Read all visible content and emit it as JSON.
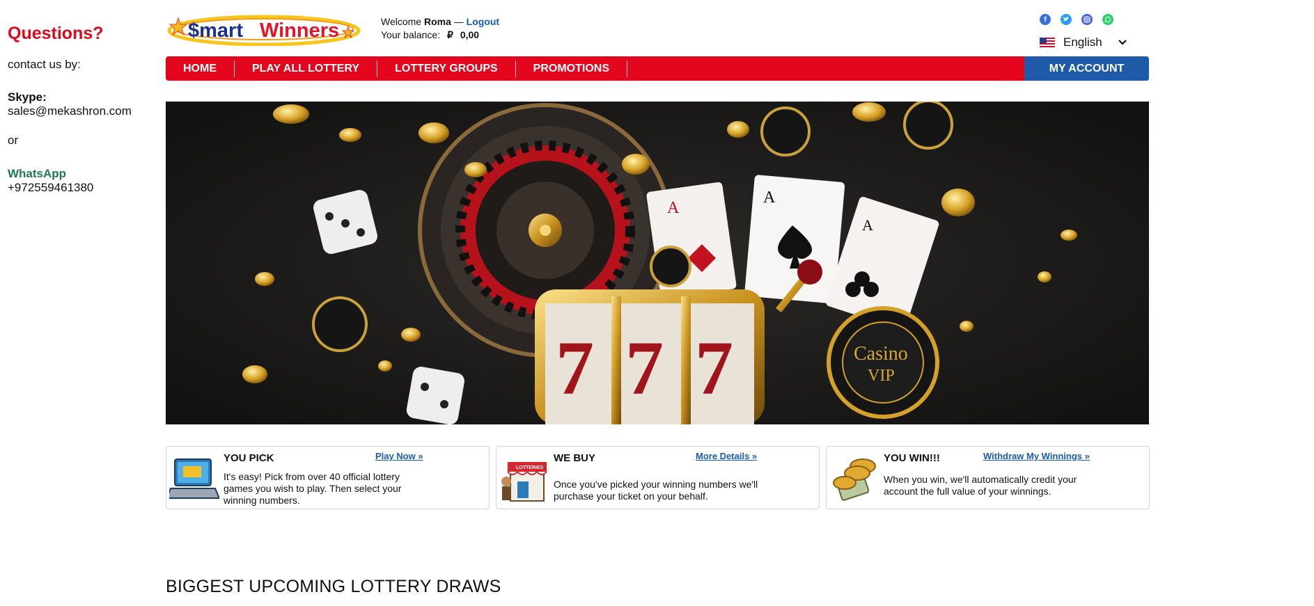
{
  "contact": {
    "heading": "Questions?",
    "intro": "contact us by:",
    "skype_label": "Skype:",
    "skype_value": "sales@mekashron.com",
    "or": "or",
    "whatsapp_label": "WhatsApp",
    "whatsapp_value": "+972559461380"
  },
  "logo": {
    "text_prefix": "$mart",
    "text_suffix": "Winners"
  },
  "header": {
    "welcome_label": "Welcome",
    "user_name": "Roma",
    "dash": "—",
    "logout": "Logout",
    "balance_label": "Your balance:",
    "currency_symbol": "₽",
    "balance_value": "0,00"
  },
  "social": {
    "icons": [
      "facebook-icon",
      "twitter-icon",
      "instagram-icon",
      "whatsapp-icon"
    ],
    "colors": [
      "#3b6fe0",
      "#2a9df4",
      "#4a60e8",
      "#25d366"
    ]
  },
  "language": {
    "selected": "English"
  },
  "nav": {
    "items": [
      "HOME",
      "PLAY ALL LOTTERY",
      "LOTTERY GROUPS",
      "PROMOTIONS"
    ],
    "account": "MY ACCOUNT",
    "color_red": "#e4061d",
    "color_blue": "#1f5aa8"
  },
  "features": [
    {
      "title": "YOU PICK",
      "link": "Play Now »",
      "text": "It's easy! Pick from over 40 official lottery games you wish to play. Then select your winning numbers."
    },
    {
      "title": "WE BUY",
      "link": "More Details »",
      "text": "Once you've picked your winning numbers we'll purchase your ticket on your behalf.",
      "icon_label": "LOTTERIES"
    },
    {
      "title": "YOU WIN!!!",
      "link": "Withdraw My Winnings »",
      "text": "When you win, we'll automatically credit your account the full value of your winnings."
    }
  ],
  "section_title": "BIGGEST UPCOMING LOTTERY DRAWS"
}
